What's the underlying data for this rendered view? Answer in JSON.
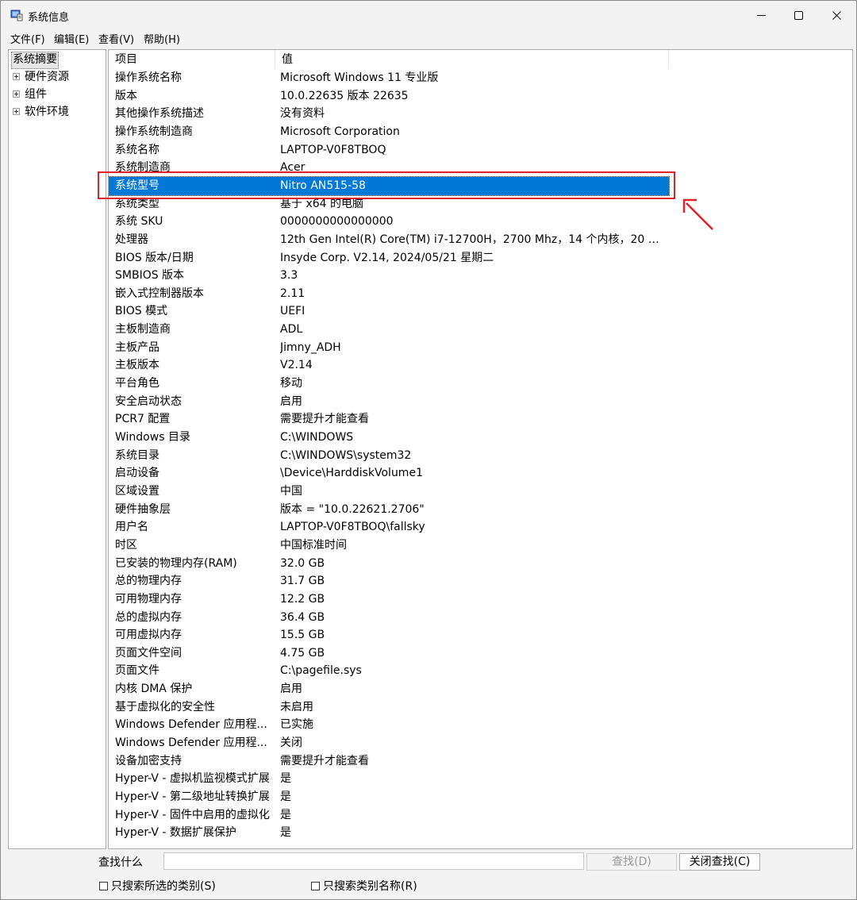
{
  "window": {
    "title": "系统信息"
  },
  "menu": [
    "文件(F)",
    "编辑(E)",
    "查看(V)",
    "帮助(H)"
  ],
  "tree": [
    {
      "label": "系统摘要",
      "selected": true,
      "expandable": false
    },
    {
      "label": "硬件资源",
      "selected": false,
      "expandable": true
    },
    {
      "label": "组件",
      "selected": false,
      "expandable": true
    },
    {
      "label": "软件环境",
      "selected": false,
      "expandable": true
    }
  ],
  "list": {
    "headers": [
      "项目",
      "值"
    ],
    "rows": [
      [
        "操作系统名称",
        "Microsoft Windows 11 专业版"
      ],
      [
        "版本",
        "10.0.22635 版本 22635"
      ],
      [
        "其他操作系统描述",
        "没有资料"
      ],
      [
        "操作系统制造商",
        "Microsoft Corporation"
      ],
      [
        "系统名称",
        "LAPTOP-V0F8TBOQ"
      ],
      [
        "系统制造商",
        "Acer"
      ],
      [
        "系统型号",
        "Nitro AN515-58"
      ],
      [
        "系统类型",
        "基于 x64 的电脑"
      ],
      [
        "系统 SKU",
        "0000000000000000"
      ],
      [
        "处理器",
        "12th Gen Intel(R) Core(TM) i7-12700H，2700 Mhz，14 个内核，20 个..."
      ],
      [
        "BIOS 版本/日期",
        "Insyde Corp. V2.14, 2024/05/21 星期二"
      ],
      [
        "SMBIOS 版本",
        "3.3"
      ],
      [
        "嵌入式控制器版本",
        "2.11"
      ],
      [
        "BIOS 模式",
        "UEFI"
      ],
      [
        "主板制造商",
        "ADL"
      ],
      [
        "主板产品",
        "Jimny_ADH"
      ],
      [
        "主板版本",
        "V2.14"
      ],
      [
        "平台角色",
        "移动"
      ],
      [
        "安全启动状态",
        "启用"
      ],
      [
        "PCR7 配置",
        "需要提升才能查看"
      ],
      [
        "Windows 目录",
        "C:\\WINDOWS"
      ],
      [
        "系统目录",
        "C:\\WINDOWS\\system32"
      ],
      [
        "启动设备",
        "\\Device\\HarddiskVolume1"
      ],
      [
        "区域设置",
        "中国"
      ],
      [
        "硬件抽象层",
        "版本 = \"10.0.22621.2706\""
      ],
      [
        "用户名",
        "LAPTOP-V0F8TBOQ\\fallsky"
      ],
      [
        "时区",
        "中国标准时间"
      ],
      [
        "已安装的物理内存(RAM)",
        "32.0 GB"
      ],
      [
        "总的物理内存",
        "31.7 GB"
      ],
      [
        "可用物理内存",
        "12.2 GB"
      ],
      [
        "总的虚拟内存",
        "36.4 GB"
      ],
      [
        "可用虚拟内存",
        "15.5 GB"
      ],
      [
        "页面文件空间",
        "4.75 GB"
      ],
      [
        "页面文件",
        "C:\\pagefile.sys"
      ],
      [
        "内核 DMA 保护",
        "启用"
      ],
      [
        "基于虚拟化的安全性",
        "未启用"
      ],
      [
        "Windows Defender 应用程...",
        "已实施"
      ],
      [
        "Windows Defender 应用程...",
        "关闭"
      ],
      [
        "设备加密支持",
        "需要提升才能查看"
      ],
      [
        "Hyper-V - 虚拟机监视模式扩展",
        "是"
      ],
      [
        "Hyper-V - 第二级地址转换扩展",
        "是"
      ],
      [
        "Hyper-V - 固件中启用的虚拟化",
        "是"
      ],
      [
        "Hyper-V - 数据扩展保护",
        "是"
      ]
    ],
    "selected_index": 6
  },
  "find": {
    "label": "查找什么",
    "value": "",
    "find_button": "查找(D)",
    "close_button": "关闭查找(C)",
    "check_selected_category": "只搜索所选的类别(S)",
    "check_category_names": "只搜索类别名称(R)"
  },
  "colors": {
    "selection": "#0078d7",
    "annotation": "#e0202a"
  },
  "icons": [
    "system-info-app-icon",
    "minimize-icon",
    "maximize-icon",
    "close-icon",
    "tree-expand-icon",
    "annotation-arrow-icon"
  ]
}
